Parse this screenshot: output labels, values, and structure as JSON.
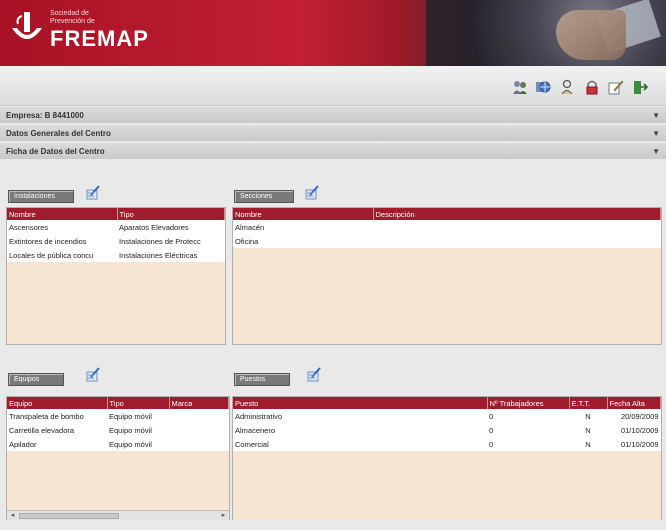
{
  "header": {
    "logo_small_line1": "Sociedad de",
    "logo_small_line2": "Prevención de",
    "logo_brand": "FREMAP"
  },
  "toolbar": {
    "icons": [
      "people-icon",
      "globe-icon",
      "user-icon",
      "lock-icon",
      "edit-icon",
      "exit-icon"
    ]
  },
  "info": {
    "empresa": "Empresa:  B 8441000",
    "datos_generales": "Datos Generales del Centro",
    "ficha": "Ficha de Datos del Centro"
  },
  "instalaciones": {
    "tab": "Instalaciones",
    "headers": [
      "Nombre",
      "Tipo"
    ],
    "rows": [
      [
        "Ascensores",
        "Aparatos Elevadores"
      ],
      [
        "Extintores de incendios",
        "Instalaciones de Protecc"
      ],
      [
        "Locales de pública concu",
        "Instalaciones Eléctricas"
      ]
    ]
  },
  "secciones": {
    "tab": "Secciones",
    "headers": [
      "Nombre",
      "Descripción"
    ],
    "rows": [
      [
        "Almacén",
        ""
      ],
      [
        "Oficina",
        ""
      ]
    ]
  },
  "equipos": {
    "tab": "Equipos",
    "headers": [
      "Equipo",
      "Tipo",
      "Marca"
    ],
    "rows": [
      [
        "Transpaleta de bombo",
        "Equipo móvil",
        ""
      ],
      [
        "Carretilla elevadora",
        "Equipo móvil",
        ""
      ],
      [
        "Apilador",
        "Equipo móvil",
        ""
      ]
    ]
  },
  "puestos": {
    "tab": "Puestos",
    "headers": [
      "Puesto",
      "Nº Trabajadores",
      "E.T.T.",
      "Fecha Alta"
    ],
    "rows": [
      [
        "Administrativo",
        "0",
        "N",
        "20/09/2009"
      ],
      [
        "Almacenero",
        "0",
        "N",
        "01/10/2009"
      ],
      [
        "Comercial",
        "0",
        "N",
        "01/10/2009"
      ]
    ]
  }
}
